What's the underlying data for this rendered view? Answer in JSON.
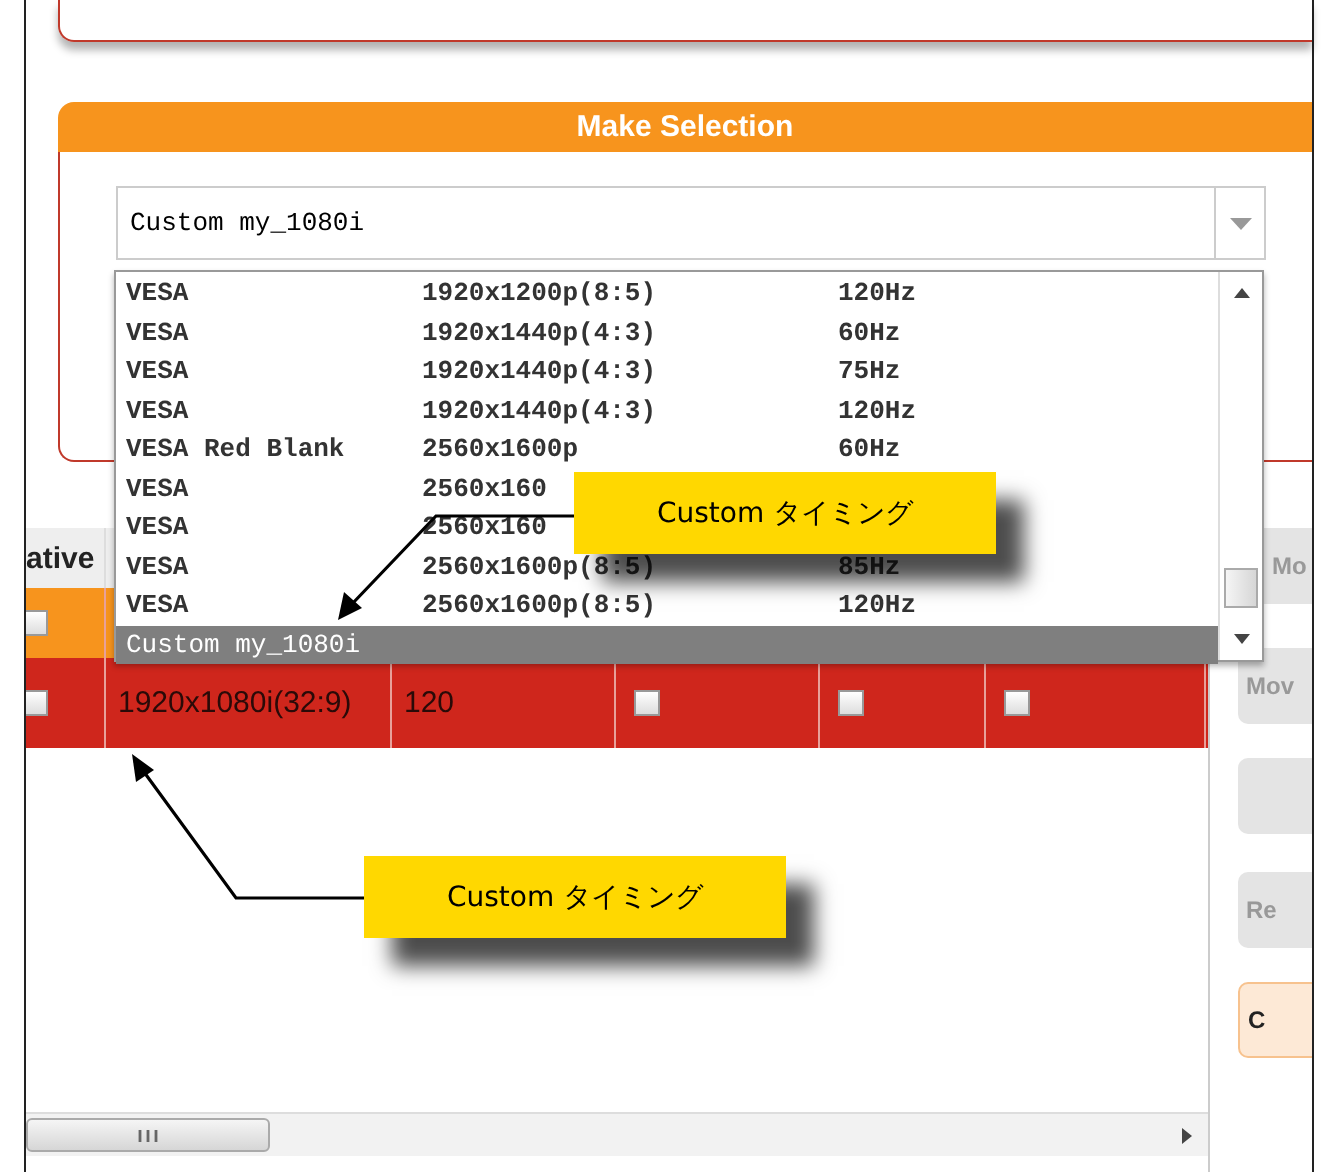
{
  "section": {
    "title": "Make Selection"
  },
  "select": {
    "value": "Custom my_1080i"
  },
  "dropdown": {
    "options": [
      {
        "standard": "VESA",
        "resolution": "1920x1200p(8:5)",
        "rate": "120Hz",
        "selected": false
      },
      {
        "standard": "VESA",
        "resolution": "1920x1440p(4:3)",
        "rate": "60Hz",
        "selected": false
      },
      {
        "standard": "VESA",
        "resolution": "1920x1440p(4:3)",
        "rate": "75Hz",
        "selected": false
      },
      {
        "standard": "VESA",
        "resolution": "1920x1440p(4:3)",
        "rate": "120Hz",
        "selected": false
      },
      {
        "standard": "VESA Red Blank",
        "resolution": "2560x1600p",
        "rate": "60Hz",
        "selected": false
      },
      {
        "standard": "VESA",
        "resolution": "2560x160",
        "selected": false
      },
      {
        "standard": "VESA",
        "resolution": "2560x160",
        "selected": false
      },
      {
        "standard": "VESA",
        "resolution": "2560x1600p(8:5)",
        "rate": "85Hz",
        "selected": false
      },
      {
        "standard": "VESA",
        "resolution": "2560x1600p(8:5)",
        "rate": "120Hz",
        "selected": false
      },
      {
        "standard": "Custom my_1080i",
        "selected": true
      }
    ]
  },
  "table": {
    "columns": [
      "ative"
    ],
    "rows": [
      {
        "color": "#f7941d",
        "cells": [
          {
            "kind": "checkbox",
            "checked": false
          }
        ]
      },
      {
        "color": "#cf261c",
        "cells": [
          {
            "kind": "checkbox",
            "checked": false
          },
          {
            "kind": "text",
            "text": "1920x1080i(32:9)"
          },
          {
            "kind": "text",
            "text": "120"
          },
          {
            "kind": "checkbox",
            "checked": false
          },
          {
            "kind": "checkbox",
            "checked": false
          },
          {
            "kind": "checkbox",
            "checked": false
          }
        ]
      }
    ]
  },
  "side_buttons": [
    {
      "label": "Mo",
      "kind": "plain"
    },
    {
      "label": "Mov",
      "kind": "plain"
    },
    {
      "kind": "plain"
    },
    {
      "label": "Re",
      "kind": "plain"
    },
    {
      "label": "C",
      "kind": "accent"
    }
  ],
  "callouts": [
    {
      "text": "Custom タイミング"
    },
    {
      "text": "Custom タイミング"
    }
  ]
}
